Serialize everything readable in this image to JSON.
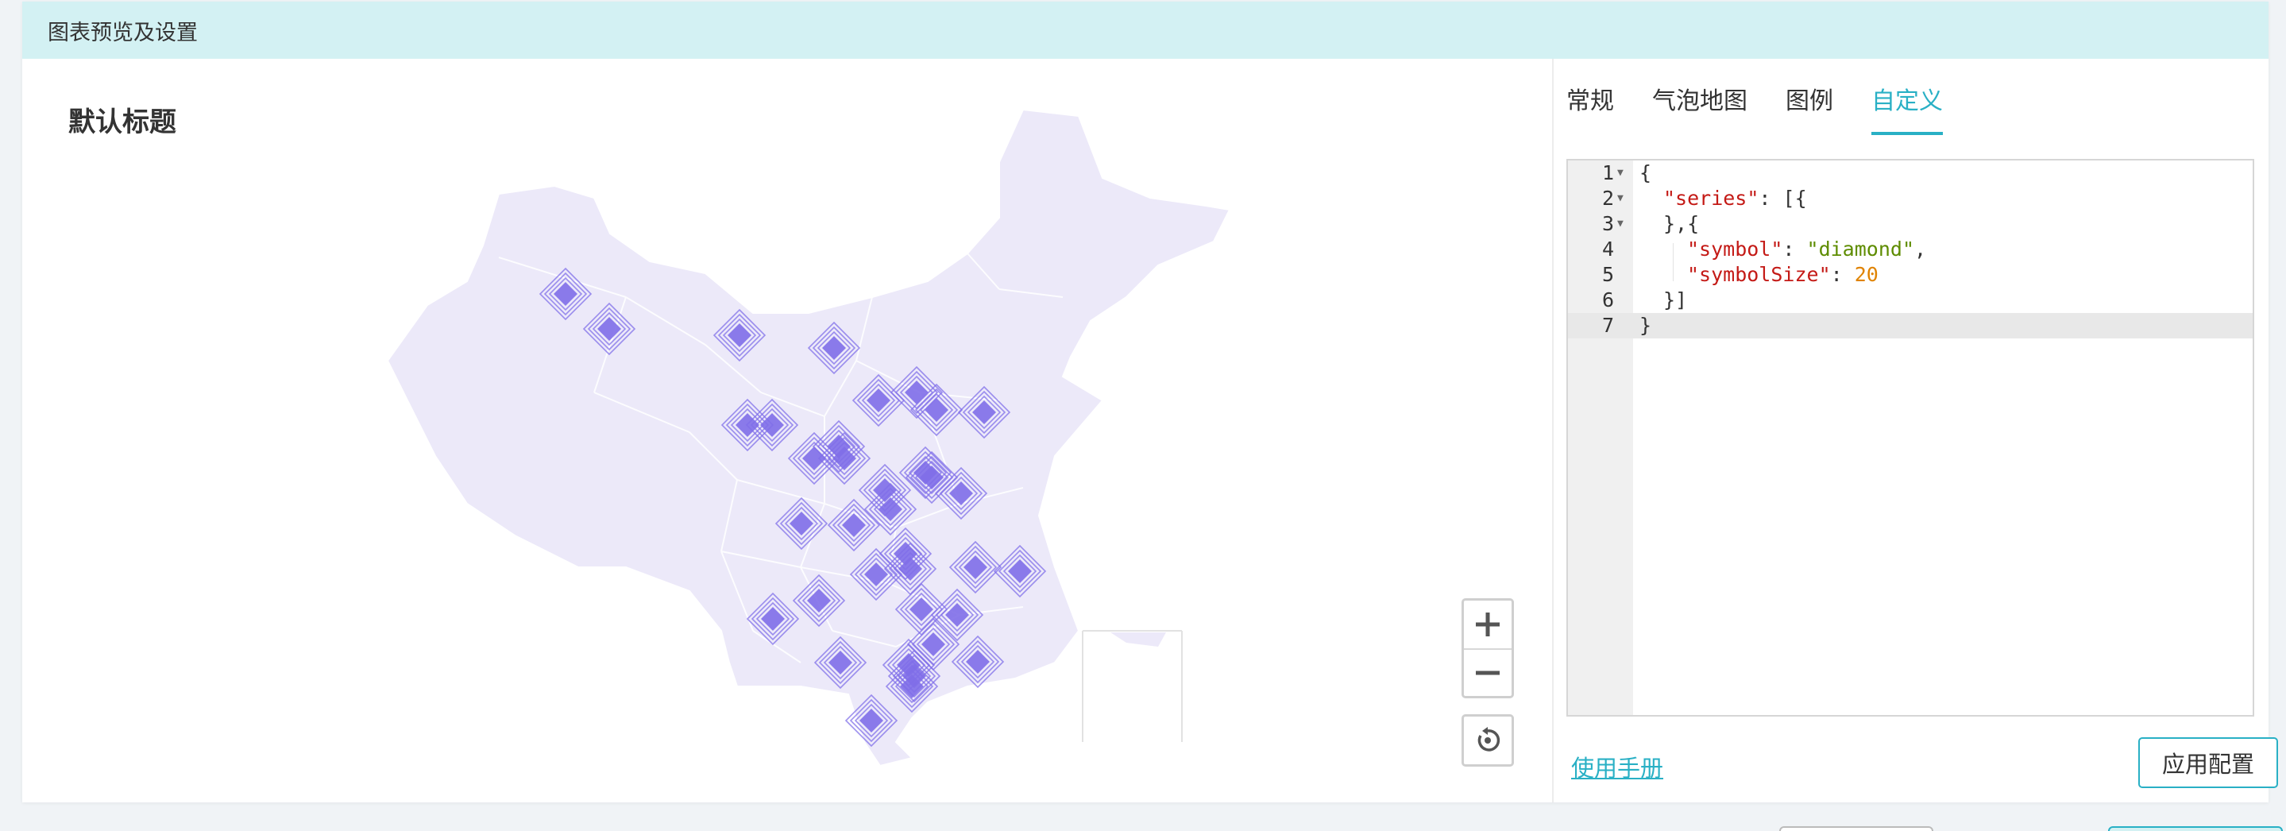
{
  "header": {
    "title": "图表预览及设置"
  },
  "chart": {
    "title": "默认标题",
    "symbol": "diamond",
    "symbol_color": "#7f6ee8",
    "map_fill": "#ece9f9",
    "marker_count": 36
  },
  "zoom": {
    "zoom_in_icon": "plus-icon",
    "zoom_out_icon": "minus-icon",
    "reset_icon": "reset-icon"
  },
  "tabs": [
    {
      "label": "常规",
      "active": false
    },
    {
      "label": "气泡地图",
      "active": false
    },
    {
      "label": "图例",
      "active": false
    },
    {
      "label": "自定义",
      "active": true
    }
  ],
  "editor": {
    "lines": [
      {
        "n": "1",
        "fold": true
      },
      {
        "n": "2",
        "fold": true
      },
      {
        "n": "3",
        "fold": true
      },
      {
        "n": "4",
        "fold": false
      },
      {
        "n": "5",
        "fold": false
      },
      {
        "n": "6",
        "fold": false
      },
      {
        "n": "7",
        "fold": false,
        "active": true
      }
    ],
    "tokens": {
      "open_brace": "{",
      "series_key": "\"series\"",
      "series_rest": ": [{",
      "close_open": "},{",
      "symbol_key": "\"symbol\"",
      "colon": ": ",
      "symbol_val": "\"diamond\"",
      "comma": ",",
      "size_key": "\"symbolSize\"",
      "size_val": "20",
      "close_arr": "}]",
      "close_brace": "}"
    }
  },
  "footer": {
    "manual_label": "使用手册",
    "apply_label": "应用配置"
  },
  "colors": {
    "accent": "#29b0c5",
    "header_bg": "#d3f1f3"
  }
}
